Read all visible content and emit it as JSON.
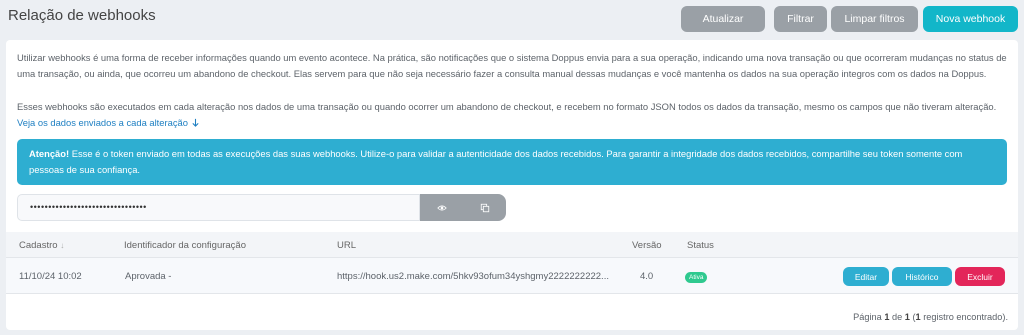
{
  "header": {
    "title": "Relação de webhooks",
    "buttons": {
      "refresh": "Atualizar",
      "filter": "Filtrar",
      "clear_filters": "Limpar filtros",
      "new_webhook": "Nova webhook"
    }
  },
  "info": {
    "paragraph1": "Utilizar webhooks é uma forma de receber informações quando um evento acontece. Na prática, são notificações que o sistema Doppus envia para a sua operação, indicando uma nova transação ou que ocorreram mudanças no status de uma transação, ou ainda, que ocorreu um abandono de checkout. Elas servem para que não seja necessário fazer a consulta manual dessas mudanças e você mantenha os dados na sua operação integros com os dados na Doppus.",
    "paragraph2": "Esses webhooks são executados em cada alteração nos dados de uma transação ou quando ocorrer um abandono de checkout, e recebem no formato JSON todos os dados da transação, mesmo os campos que não tiveram alteração.",
    "link": "Veja os dados enviados a cada alteração"
  },
  "alert": {
    "strong": "Atenção!",
    "text": " Esse é o token enviado em todas as execuções das suas webhooks. Utilize-o para validar a autenticidade dos dados recebidos. Para garantir a integridade dos dados recebidos, compartilhe seu token somente com pessoas de sua confiança."
  },
  "token": {
    "value": "••••••••••••••••••••••••••••••••",
    "show_icon": "eye-icon",
    "copy_icon": "copy-icon"
  },
  "table": {
    "columns": {
      "cadastro": "Cadastro",
      "sort_icon": "↓",
      "identifier": "Identificador da configuração",
      "url": "URL",
      "version": "Versão",
      "status": "Status"
    },
    "rows": [
      {
        "cadastro": "11/10/24 10:02",
        "identifier": "Aprovada -",
        "url": "https://hook.us2.make.com/5hkv93ofum34yshgmy2222222222...",
        "version": "4.0",
        "status": "Ativa",
        "actions": {
          "edit": "Editar",
          "history": "Histórico",
          "delete": "Excluir"
        }
      }
    ]
  },
  "pagination": {
    "prefix": "Página ",
    "current": "1",
    "of": " de ",
    "total": "1",
    "suffix_open": " (",
    "count": "1",
    "suffix": " registro encontrado)."
  },
  "colors": {
    "primary": "#12b6c9",
    "gray_button": "#9aa0a6",
    "alert_bg": "#2eaed1",
    "danger": "#e3265a",
    "status_active": "#2fc98f"
  }
}
